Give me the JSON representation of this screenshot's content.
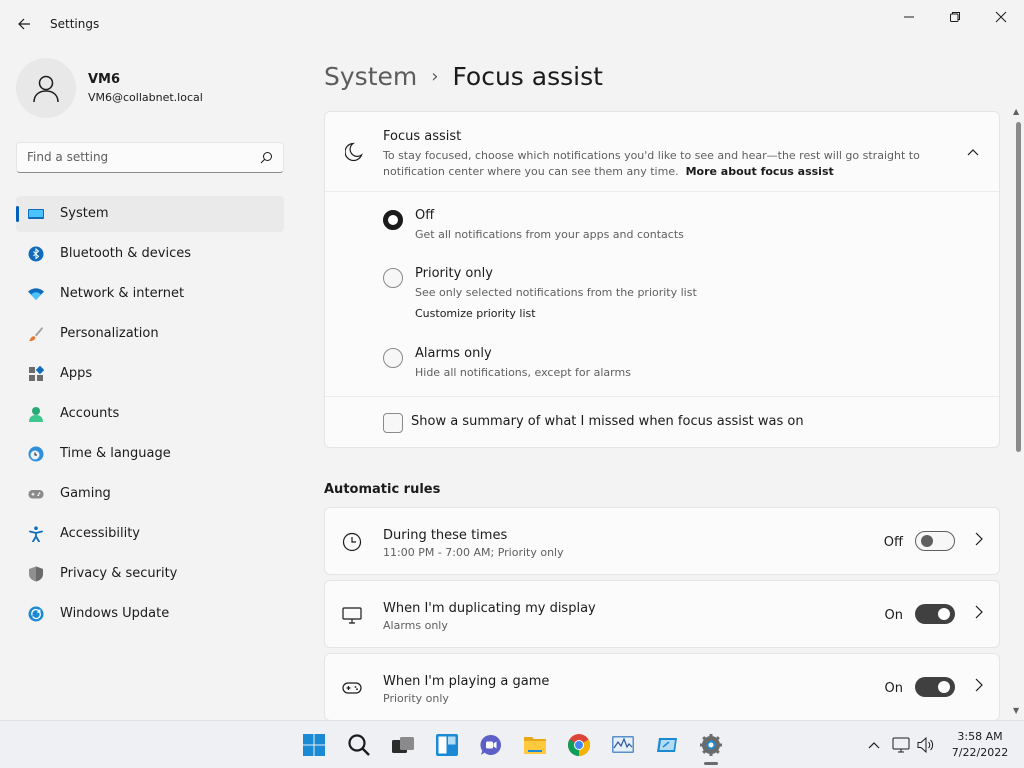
{
  "window": {
    "title": "Settings",
    "controls": {
      "minimize": "minimize",
      "maximize": "maximize",
      "close": "close"
    }
  },
  "profile": {
    "name": "VM6",
    "email": "VM6@collabnet.local"
  },
  "search": {
    "placeholder": "Find a setting"
  },
  "sidebar": {
    "items": [
      {
        "label": "System",
        "icon": "system-icon",
        "active": true
      },
      {
        "label": "Bluetooth & devices",
        "icon": "bluetooth-icon"
      },
      {
        "label": "Network & internet",
        "icon": "wifi-icon"
      },
      {
        "label": "Personalization",
        "icon": "brush-icon"
      },
      {
        "label": "Apps",
        "icon": "apps-icon"
      },
      {
        "label": "Accounts",
        "icon": "accounts-icon"
      },
      {
        "label": "Time & language",
        "icon": "time-language-icon"
      },
      {
        "label": "Gaming",
        "icon": "gamepad-icon"
      },
      {
        "label": "Accessibility",
        "icon": "accessibility-icon"
      },
      {
        "label": "Privacy & security",
        "icon": "shield-icon"
      },
      {
        "label": "Windows Update",
        "icon": "update-icon"
      }
    ]
  },
  "breadcrumb": {
    "parent": "System",
    "separator": "›",
    "current": "Focus assist"
  },
  "focus_assist": {
    "title": "Focus assist",
    "description": "To stay focused, choose which notifications you'd like to see and hear—the rest will go straight to notification center where you can see them any time.",
    "link": "More about focus assist",
    "options": [
      {
        "label": "Off",
        "sub": "Get all notifications from your apps and contacts",
        "checked": true
      },
      {
        "label": "Priority only",
        "sub": "See only selected notifications from the priority list",
        "link": "Customize priority list"
      },
      {
        "label": "Alarms only",
        "sub": "Hide all notifications, except for alarms"
      }
    ],
    "summary_checkbox": {
      "label": "Show a summary of what I missed when focus assist was on",
      "checked": false
    }
  },
  "automatic_rules": {
    "title": "Automatic rules",
    "rules": [
      {
        "title": "During these times",
        "sub": "11:00 PM - 7:00 AM; Priority only",
        "state": "Off",
        "on": false,
        "icon": "clock-icon"
      },
      {
        "title": "When I'm duplicating my display",
        "sub": "Alarms only",
        "state": "On",
        "on": true,
        "icon": "monitor-icon"
      },
      {
        "title": "When I'm playing a game",
        "sub": "Priority only",
        "state": "On",
        "on": true,
        "icon": "gamepad-icon"
      }
    ]
  },
  "taskbar": {
    "apps": [
      "start-icon",
      "search-icon",
      "task-view-icon",
      "widgets-icon",
      "chat-icon",
      "file-explorer-icon",
      "chrome-icon",
      "performance-monitor-icon",
      "remote-desktop-icon",
      "settings-icon"
    ],
    "clock": {
      "time": "3:58 AM",
      "date": "7/22/2022"
    }
  },
  "colors": {
    "accent": "#005fb8",
    "toggle_on": "#404040",
    "background": "#f3f3f3",
    "card": "#fbfbfb"
  }
}
